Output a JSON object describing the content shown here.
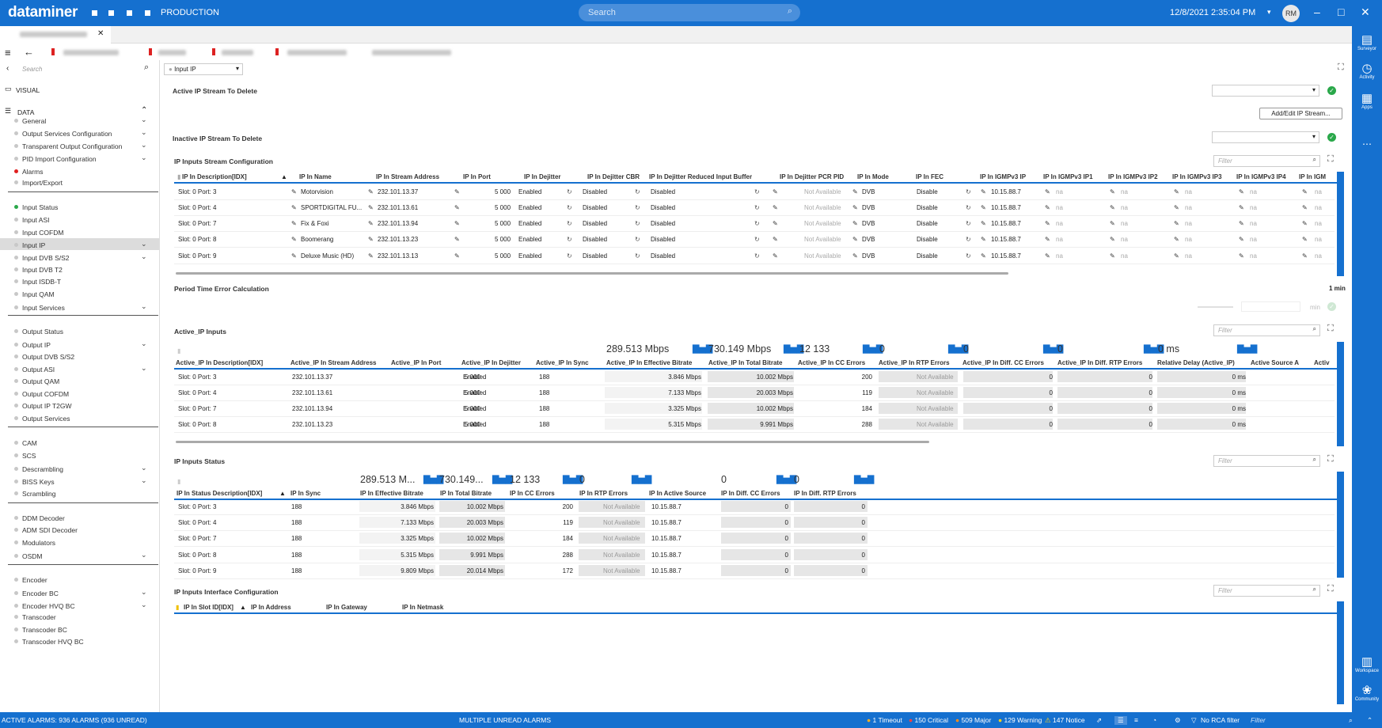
{
  "app": {
    "logo": "dataminer",
    "env": "PRODUCTION",
    "search_placeholder": "Search",
    "clock": "12/8/2021 2:35:04 PM",
    "user_initials": "RM",
    "accent": "#1570cf"
  },
  "toolbar": {
    "search_placeholder": "Search",
    "view_select": "Input IP"
  },
  "sidebar": {
    "visual": "VISUAL",
    "data": "DATA",
    "groups": [
      [
        "General",
        "Output Services Configuration",
        "Transparent Output Configuration",
        "PID Import Configuration",
        "Alarms",
        "Import/Export"
      ],
      [
        "Input Status",
        "Input ASI",
        "Input COFDM",
        "Input IP",
        "Input DVB S/S2",
        "Input DVB T2",
        "Input ISDB-T",
        "Input QAM",
        "Input Services"
      ],
      [
        "Output Status",
        "Output IP",
        "Output DVB S/S2",
        "Output ASI",
        "Output QAM",
        "Output COFDM",
        "Output IP T2GW",
        "Output Services"
      ],
      [
        "CAM",
        "SCS",
        "Descrambling",
        "BISS Keys",
        "Scrambling"
      ],
      [
        "DDM Decoder",
        "ADM SDI Decoder",
        "Modulators",
        "OSDM"
      ],
      [
        "Encoder",
        "Encoder BC",
        "Encoder HVQ BC",
        "Transcoder",
        "Transcoder BC",
        "Transcoder HVQ BC"
      ]
    ]
  },
  "sections": {
    "active_delete": "Active IP Stream To Delete",
    "inactive_delete": "Inactive IP Stream To Delete",
    "add_edit_btn": "Add/Edit IP Stream...",
    "stream_config": "IP Inputs Stream Configuration",
    "period": "Period Time Error Calculation",
    "period_value": "1 min",
    "period_unit": "min",
    "active_inputs": "Active_IP Inputs",
    "status": "IP Inputs Status",
    "iface": "IP Inputs Interface Configuration",
    "filter": "Filter"
  },
  "stream_config": {
    "headers": [
      "IP In Description[IDX]",
      "IP In Name",
      "IP In Stream Address",
      "IP In Port",
      "IP In Dejitter",
      "IP In Dejitter CBR",
      "IP In Dejitter Reduced Input Buffer",
      "IP In Dejitter PCR PID",
      "IP In Mode",
      "IP In FEC",
      "IP In IGMPv3 IP",
      "IP In IGMPv3 IP1",
      "IP In IGMPv3 IP2",
      "IP In IGMPv3 IP3",
      "IP In IGMPv3 IP4",
      "IP In IGM"
    ],
    "rows": [
      [
        "Slot: 0 Port: 3",
        "Motorvision",
        "232.101.13.37",
        "5 000",
        "Enabled",
        "Disabled",
        "Disabled",
        "Not Available",
        "DVB",
        "Disable",
        "10.15.88.7",
        "na",
        "na",
        "na",
        "na",
        "na"
      ],
      [
        "Slot: 0 Port: 4",
        "SPORTDIGITAL FU...",
        "232.101.13.61",
        "5 000",
        "Enabled",
        "Disabled",
        "Disabled",
        "Not Available",
        "DVB",
        "Disable",
        "10.15.88.7",
        "na",
        "na",
        "na",
        "na",
        "na"
      ],
      [
        "Slot: 0 Port: 7",
        "Fix & Foxi",
        "232.101.13.94",
        "5 000",
        "Enabled",
        "Disabled",
        "Disabled",
        "Not Available",
        "DVB",
        "Disable",
        "10.15.88.7",
        "na",
        "na",
        "na",
        "na",
        "na"
      ],
      [
        "Slot: 0 Port: 8",
        "Boomerang",
        "232.101.13.23",
        "5 000",
        "Enabled",
        "Disabled",
        "Disabled",
        "Not Available",
        "DVB",
        "Disable",
        "10.15.88.7",
        "na",
        "na",
        "na",
        "na",
        "na"
      ],
      [
        "Slot: 0 Port: 9",
        "Deluxe Music (HD)",
        "232.101.13.13",
        "5 000",
        "Enabled",
        "Disabled",
        "Disabled",
        "Not Available",
        "DVB",
        "Disable",
        "10.15.88.7",
        "na",
        "na",
        "na",
        "na",
        "na"
      ]
    ]
  },
  "active_inputs": {
    "totals": [
      "289.513 Mbps",
      "730.149 Mbps",
      "12 133",
      "0",
      "0",
      "0",
      "0 ms"
    ],
    "headers": [
      "Active_IP In Description[IDX]",
      "Active_IP In Stream Address",
      "Active_IP In Port",
      "Active_IP In Dejitter",
      "Active_IP In Sync",
      "Active_IP In Effective Bitrate",
      "Active_IP In Total Bitrate",
      "Active_IP In CC Errors",
      "Active_IP In RTP Errors",
      "Active_IP In Diff. CC Errors",
      "Active_IP In Diff. RTP Errors",
      "Relative Delay (Active_IP)",
      "Active Source A",
      "Activ"
    ],
    "rows": [
      [
        "Slot: 0 Port: 3",
        "232.101.13.37",
        "5 000",
        "Enabled",
        "188",
        "3.846 Mbps",
        "10.002 Mbps",
        "200",
        "Not Available",
        "0",
        "0",
        "0 ms"
      ],
      [
        "Slot: 0 Port: 4",
        "232.101.13.61",
        "5 000",
        "Enabled",
        "188",
        "7.133 Mbps",
        "20.003 Mbps",
        "119",
        "Not Available",
        "0",
        "0",
        "0 ms"
      ],
      [
        "Slot: 0 Port: 7",
        "232.101.13.94",
        "5 000",
        "Enabled",
        "188",
        "3.325 Mbps",
        "10.002 Mbps",
        "184",
        "Not Available",
        "0",
        "0",
        "0 ms"
      ],
      [
        "Slot: 0 Port: 8",
        "232.101.13.23",
        "5 000",
        "Enabled",
        "188",
        "5.315 Mbps",
        "9.991 Mbps",
        "288",
        "Not Available",
        "0",
        "0",
        "0 ms"
      ]
    ]
  },
  "status": {
    "totals": [
      "289.513 M...",
      "730.149...",
      "12 133",
      "0",
      "0",
      "0"
    ],
    "headers": [
      "IP In Status Description[IDX]",
      "IP In Sync",
      "IP In Effective Bitrate",
      "IP In Total Bitrate",
      "IP In CC Errors",
      "IP In RTP Errors",
      "IP In Active Source",
      "IP In Diff. CC Errors",
      "IP In Diff. RTP Errors"
    ],
    "rows": [
      [
        "Slot: 0 Port: 3",
        "188",
        "3.846 Mbps",
        "10.002 Mbps",
        "200",
        "Not Available",
        "10.15.88.7",
        "0",
        "0"
      ],
      [
        "Slot: 0 Port: 4",
        "188",
        "7.133 Mbps",
        "20.003 Mbps",
        "119",
        "Not Available",
        "10.15.88.7",
        "0",
        "0"
      ],
      [
        "Slot: 0 Port: 7",
        "188",
        "3.325 Mbps",
        "10.002 Mbps",
        "184",
        "Not Available",
        "10.15.88.7",
        "0",
        "0"
      ],
      [
        "Slot: 0 Port: 8",
        "188",
        "5.315 Mbps",
        "9.991 Mbps",
        "288",
        "Not Available",
        "10.15.88.7",
        "0",
        "0"
      ],
      [
        "Slot: 0 Port: 9",
        "188",
        "9.809 Mbps",
        "20.014 Mbps",
        "172",
        "Not Available",
        "10.15.88.7",
        "0",
        "0"
      ]
    ]
  },
  "iface": {
    "headers": [
      "IP In Slot ID[IDX]",
      "IP In Address",
      "IP In Gateway",
      "IP In Netmask"
    ]
  },
  "rightbar": [
    "Surveyor",
    "Activity",
    "Apps",
    "Workspace",
    "Community"
  ],
  "statusbar": {
    "alarms": "ACTIVE ALARMS: 936 ALARMS (936 UNREAD)",
    "center": "MULTIPLE UNREAD ALARMS",
    "timeout": "1 Timeout",
    "critical": "150 Critical",
    "major": "509 Major",
    "warning": "129 Warning",
    "notice": "147 Notice",
    "rca": "No RCA filter",
    "filter": "Filter"
  }
}
